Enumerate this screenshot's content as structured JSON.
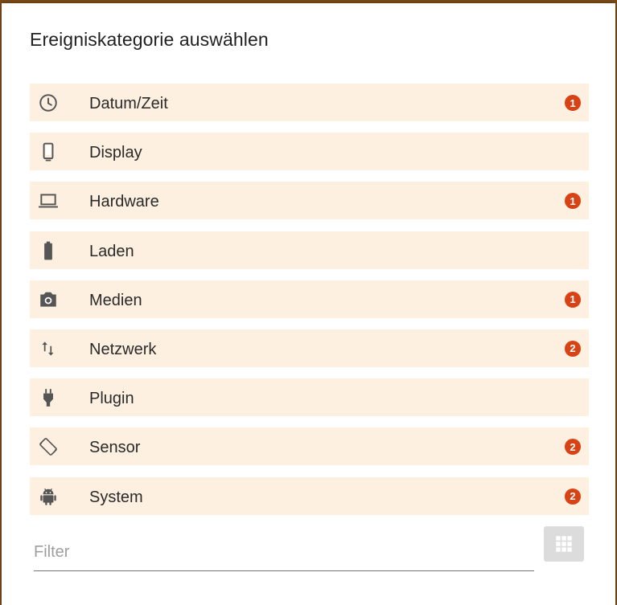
{
  "dialog": {
    "title": "Ereigniskategorie auswählen"
  },
  "categories": [
    {
      "label": "Datum/Zeit",
      "icon": "clock-icon",
      "badge": "1"
    },
    {
      "label": "Display",
      "icon": "phone-icon",
      "badge": ""
    },
    {
      "label": "Hardware",
      "icon": "laptop-icon",
      "badge": "1"
    },
    {
      "label": "Laden",
      "icon": "battery-icon",
      "badge": ""
    },
    {
      "label": "Medien",
      "icon": "camera-icon",
      "badge": "1"
    },
    {
      "label": "Netzwerk",
      "icon": "swap-vert-icon",
      "badge": "2"
    },
    {
      "label": "Plugin",
      "icon": "plug-icon",
      "badge": ""
    },
    {
      "label": "Sensor",
      "icon": "screen-rotation-icon",
      "badge": "2"
    },
    {
      "label": "System",
      "icon": "android-icon",
      "badge": "2"
    }
  ],
  "filter": {
    "placeholder": "Filter",
    "value": ""
  },
  "colors": {
    "item_background": "#fdf0e0",
    "badge": "#d84315",
    "icon": "#555555"
  }
}
